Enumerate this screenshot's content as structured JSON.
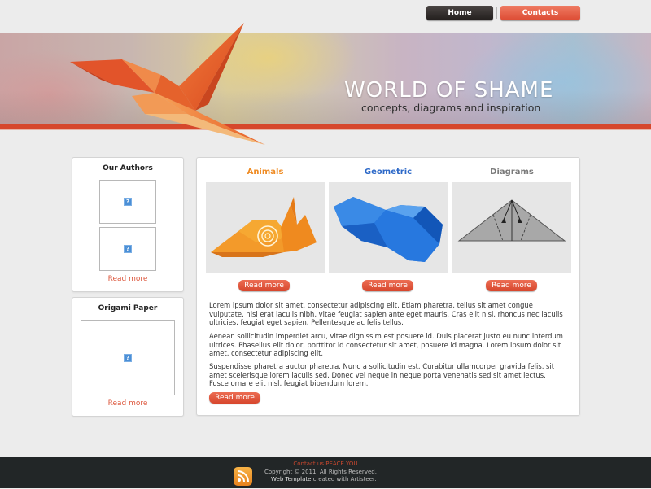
{
  "nav": {
    "home": "Home",
    "contacts": "Contacts"
  },
  "header": {
    "title": "WORLD OF SHAME",
    "slogan": "concepts, diagrams and inspiration"
  },
  "sidebar": {
    "authors": {
      "title": "Our Authors",
      "read_more": "Read more"
    },
    "paper": {
      "title": "Origami Paper",
      "read_more": "Read more"
    }
  },
  "main": {
    "columns": [
      {
        "title": "Animals",
        "color": "#ef8b23",
        "read_more": "Read more"
      },
      {
        "title": "Geometric",
        "color": "#2d69c8",
        "read_more": "Read more"
      },
      {
        "title": "Diagrams",
        "color": "#7a7a7a",
        "read_more": "Read more"
      }
    ],
    "paragraphs": [
      "Lorem ipsum dolor sit amet, consectetur adipiscing elit. Etiam pharetra, tellus sit amet congue vulputate, nisi erat iaculis nibh, vitae feugiat sapien ante eget mauris. Cras elit nisl, rhoncus nec iaculis ultricies, feugiat eget sapien. Pellentesque ac felis tellus.",
      "Aenean sollicitudin imperdiet arcu, vitae dignissim est posuere id. Duis placerat justo eu nunc interdum ultrices. Phasellus elit dolor, porttitor id consectetur sit amet, posuere id magna. Lorem ipsum dolor sit amet, consectetur adipiscing elit.",
      "Suspendisse pharetra auctor pharetra. Nunc a sollicitudin est. Curabitur ullamcorper gravida felis, sit amet scelerisque lorem iaculis sed. Donec vel neque in neque porta venenatis sed sit amet lectus. Fusce ornare elit nisl, feugiat bibendum lorem."
    ],
    "read_more": "Read more"
  },
  "footer": {
    "contact": "Contact us PEACE YOU",
    "copyright": "Copyright © 2011. All Rights Reserved.",
    "template_link": "Web Template",
    "created": "created with Artisteer."
  },
  "colors": {
    "accent": "#d6472c",
    "footer_bg": "#222627"
  }
}
